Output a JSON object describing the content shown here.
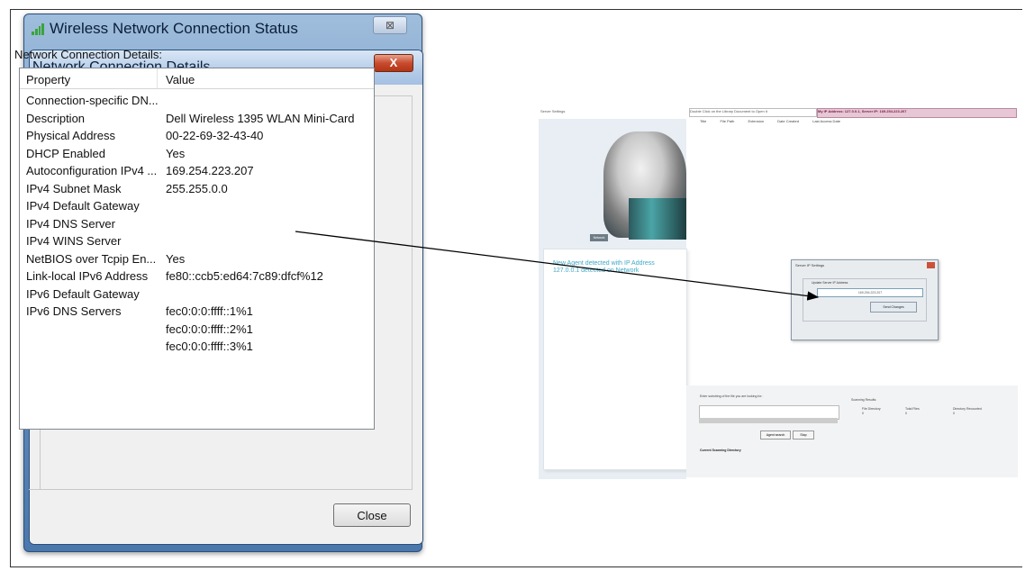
{
  "dialog": {
    "outer_title": "Wireless Network Connection Status",
    "inner_title": "Network Connection Details",
    "group_label": "Network Connection Details:",
    "columns": {
      "property": "Property",
      "value": "Value"
    },
    "rows": [
      {
        "property": "Connection-specific DN...",
        "value": ""
      },
      {
        "property": "Description",
        "value": "Dell Wireless 1395 WLAN Mini-Card"
      },
      {
        "property": "Physical Address",
        "value": "00-22-69-32-43-40"
      },
      {
        "property": "DHCP Enabled",
        "value": "Yes"
      },
      {
        "property": "Autoconfiguration IPv4 ...",
        "value": "169.254.223.207"
      },
      {
        "property": "IPv4 Subnet Mask",
        "value": "255.255.0.0"
      },
      {
        "property": "IPv4 Default Gateway",
        "value": ""
      },
      {
        "property": "IPv4 DNS Server",
        "value": ""
      },
      {
        "property": "IPv4 WINS Server",
        "value": ""
      },
      {
        "property": "NetBIOS over Tcpip En...",
        "value": "Yes"
      },
      {
        "property": "Link-local IPv6 Address",
        "value": "fe80::ccb5:ed64:7c89:dfcf%12"
      },
      {
        "property": "IPv6 Default Gateway",
        "value": ""
      },
      {
        "property": "IPv6 DNS Servers",
        "value": "fec0:0:0:ffff::1%1"
      },
      {
        "property": "",
        "value": "fec0:0:0:ffff::2%1"
      },
      {
        "property": "",
        "value": "fec0:0:0:ffff::3%1"
      }
    ],
    "close_label": "Close",
    "title_close_glyph": "X",
    "outer_close_glyph": "⊠"
  },
  "app": {
    "server_settings_tab": "Server Settings",
    "hint_tab": "Double Click on the Library Document to Open it",
    "ip_tab": "My IP Address: 127.0.0.1, Server IP: 169.254.223.207",
    "columns": [
      "Title",
      "File Path",
      "Extension",
      "Date Created",
      "Last Access Date"
    ],
    "network_badge": "Network",
    "agent_message": "New Agent detected with IP Address 127.0.0.1 detected on Network",
    "ip_dialog": {
      "title": "Server IP Settings",
      "label": "Update Server IP Address",
      "value": "169.254.223.207",
      "button": "Send Changes"
    },
    "search_label": "Enter substring of the file you are looking for:",
    "agent_search_button": "Agent search",
    "stop_button": "Stop",
    "current_dirs_label": "Current Scanning Directory",
    "scan_results": {
      "title": "Scanning Results:",
      "headers": [
        "File Directory",
        "Total Files",
        "Directory Recounted"
      ],
      "values": [
        "0",
        "0",
        "0"
      ]
    }
  }
}
